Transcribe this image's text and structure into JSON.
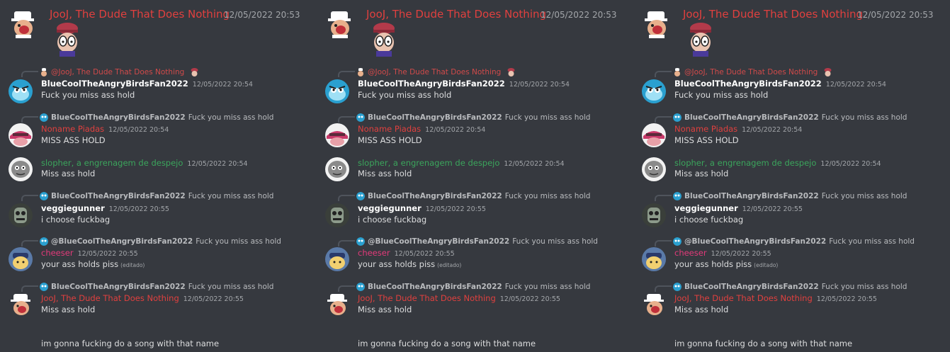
{
  "header": {
    "author": "JooJ, The Dude That Does Nothing",
    "timestamp": "12/05/2022 20:53"
  },
  "messages": [
    {
      "reply": {
        "name": "@JooJ, The Dude That Does Nothing",
        "text": ""
      },
      "author": "BlueCoolTheAngryBirdsFan2022",
      "timestamp": "12/05/2022 20:54",
      "content": "Fuck you miss ass hold"
    },
    {
      "reply": {
        "name": "BlueCoolTheAngryBirdsFan2022",
        "text": "Fuck you miss ass hold"
      },
      "author": "Noname Piadas",
      "timestamp": "12/05/2022 20:54",
      "content": "MISS ASS HOLD"
    },
    {
      "author": "slopher, a engrenagem de despejo",
      "timestamp": "12/05/2022 20:54",
      "content": "Miss ass hold"
    },
    {
      "reply": {
        "name": "BlueCoolTheAngryBirdsFan2022",
        "text": "Fuck you miss ass hold"
      },
      "author": "veggiegunner",
      "timestamp": "12/05/2022 20:55",
      "content": "i choose fuckbag"
    },
    {
      "reply": {
        "name": "@BlueCoolTheAngryBirdsFan2022",
        "text": "Fuck you miss ass hold"
      },
      "author": "cheeser",
      "timestamp": "12/05/2022 20:55",
      "content": "your ass holds piss",
      "edited": "(editado)"
    },
    {
      "reply": {
        "name": "BlueCoolTheAngryBirdsFan2022",
        "text": "Fuck you miss ass hold"
      },
      "author": "JooJ, The Dude That Does Nothing",
      "timestamp": "12/05/2022 20:55",
      "content": "Miss ass hold",
      "content2": "im gonna fucking do a song with that name"
    }
  ]
}
